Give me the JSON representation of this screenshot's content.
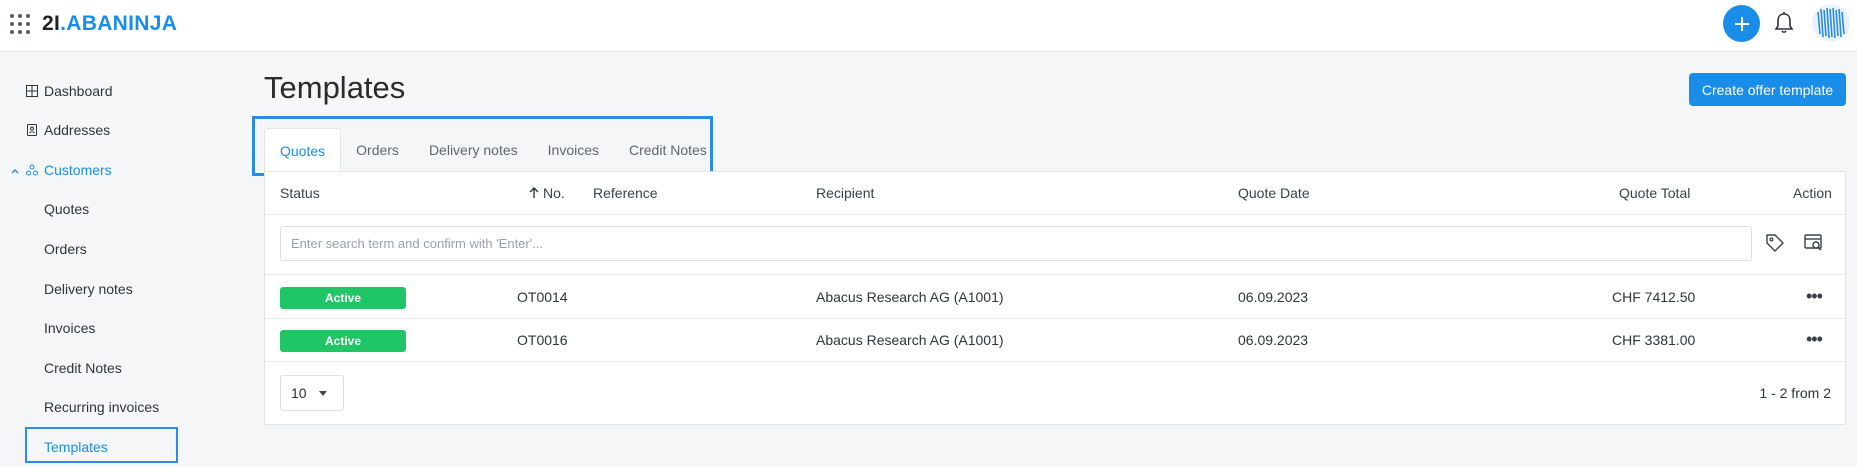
{
  "header": {
    "logo_num": "2I",
    "logo_dot": ".",
    "logo_name": "ABANINJA"
  },
  "sidebar": {
    "dashboard": "Dashboard",
    "addresses": "Addresses",
    "customers": "Customers",
    "sub_items": [
      "Quotes",
      "Orders",
      "Delivery notes",
      "Invoices",
      "Credit Notes",
      "Recurring invoices",
      "Templates"
    ]
  },
  "page": {
    "title": "Templates",
    "create_button": "Create offer template"
  },
  "tabs": [
    "Quotes",
    "Orders",
    "Delivery notes",
    "Invoices",
    "Credit Notes"
  ],
  "table": {
    "columns": {
      "status": "Status",
      "no": "No.",
      "reference": "Reference",
      "recipient": "Recipient",
      "date": "Quote Date",
      "total": "Quote Total",
      "action": "Action"
    },
    "search_placeholder": "Enter search term and confirm with 'Enter'...",
    "rows": [
      {
        "status": "Active",
        "no": "OT0014",
        "reference": "",
        "recipient": "Abacus Research AG (A1001)",
        "date": "06.09.2023",
        "total": "CHF 7412.50"
      },
      {
        "status": "Active",
        "no": "OT0016",
        "reference": "",
        "recipient": "Abacus Research AG (A1001)",
        "date": "06.09.2023",
        "total": "CHF 3381.00"
      }
    ],
    "page_size": "10",
    "pager_info": "1 - 2 from 2"
  },
  "colors": {
    "accent": "#1a8de9",
    "active_badge": "#20c566",
    "highlight_border": "#2a8be8"
  }
}
